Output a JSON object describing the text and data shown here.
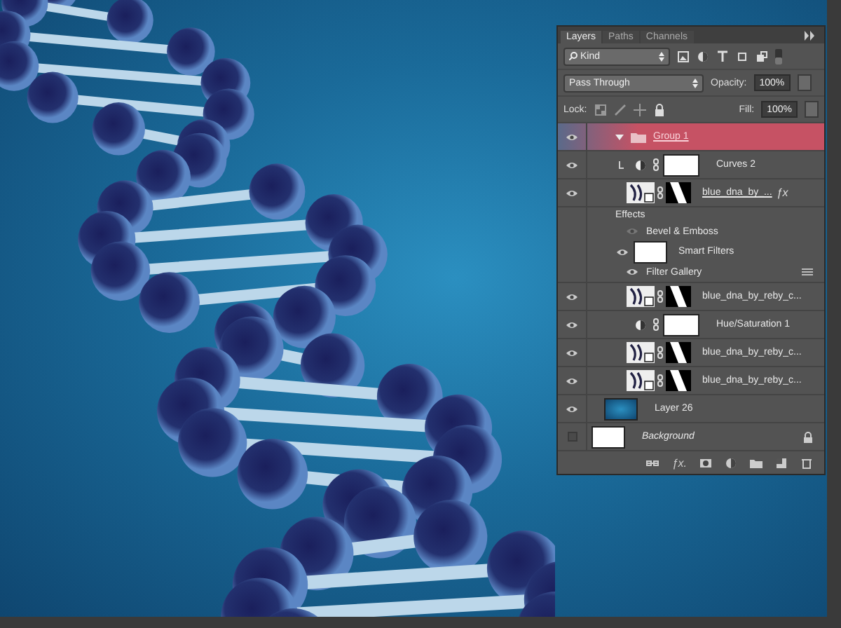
{
  "panel": {
    "tabs": [
      {
        "label": "Layers",
        "selected": true
      },
      {
        "label": "Paths",
        "selected": false
      },
      {
        "label": "Channels",
        "selected": false
      }
    ],
    "filter": {
      "value": "Kind"
    },
    "blend_mode": {
      "value": "Pass Through"
    },
    "opacity": {
      "label": "Opacity:",
      "value": "100%"
    },
    "lock": {
      "label": "Lock:"
    },
    "fill": {
      "label": "Fill:",
      "value": "100%"
    },
    "footer": {
      "add_style": "ƒx."
    },
    "layers": [
      {
        "kind": "group",
        "name": "Group 1",
        "visible": true,
        "selected": true,
        "expanded": true,
        "children": [
          {
            "kind": "adjustment",
            "name": "Curves 2",
            "visible": true,
            "selected": false,
            "clipped": true
          },
          {
            "kind": "smart",
            "name": "blue_dna_by_...",
            "visible": true,
            "selected": false,
            "fx_badge": "ƒx",
            "effects_label": "Effects",
            "effects": [
              {
                "name": "Bevel & Emboss",
                "visible": true
              }
            ],
            "smart_filters": {
              "label": "Smart Filters",
              "visible": true,
              "filters": [
                {
                  "name": "Filter Gallery",
                  "visible": true
                }
              ]
            }
          },
          {
            "kind": "smart",
            "name": "blue_dna_by_reby_c...",
            "visible": true,
            "selected": false
          },
          {
            "kind": "adjustment",
            "name": "Hue/Saturation 1",
            "visible": true,
            "selected": false
          },
          {
            "kind": "smart",
            "name": "blue_dna_by_reby_c...",
            "visible": true,
            "selected": false
          },
          {
            "kind": "smart",
            "name": "blue_dna_by_reby_c...",
            "visible": true,
            "selected": false
          }
        ]
      },
      {
        "kind": "pixel",
        "name": "Layer 26",
        "visible": true,
        "selected": false
      },
      {
        "kind": "background",
        "name": "Background",
        "visible": false,
        "selected": false,
        "locked": true
      }
    ]
  }
}
